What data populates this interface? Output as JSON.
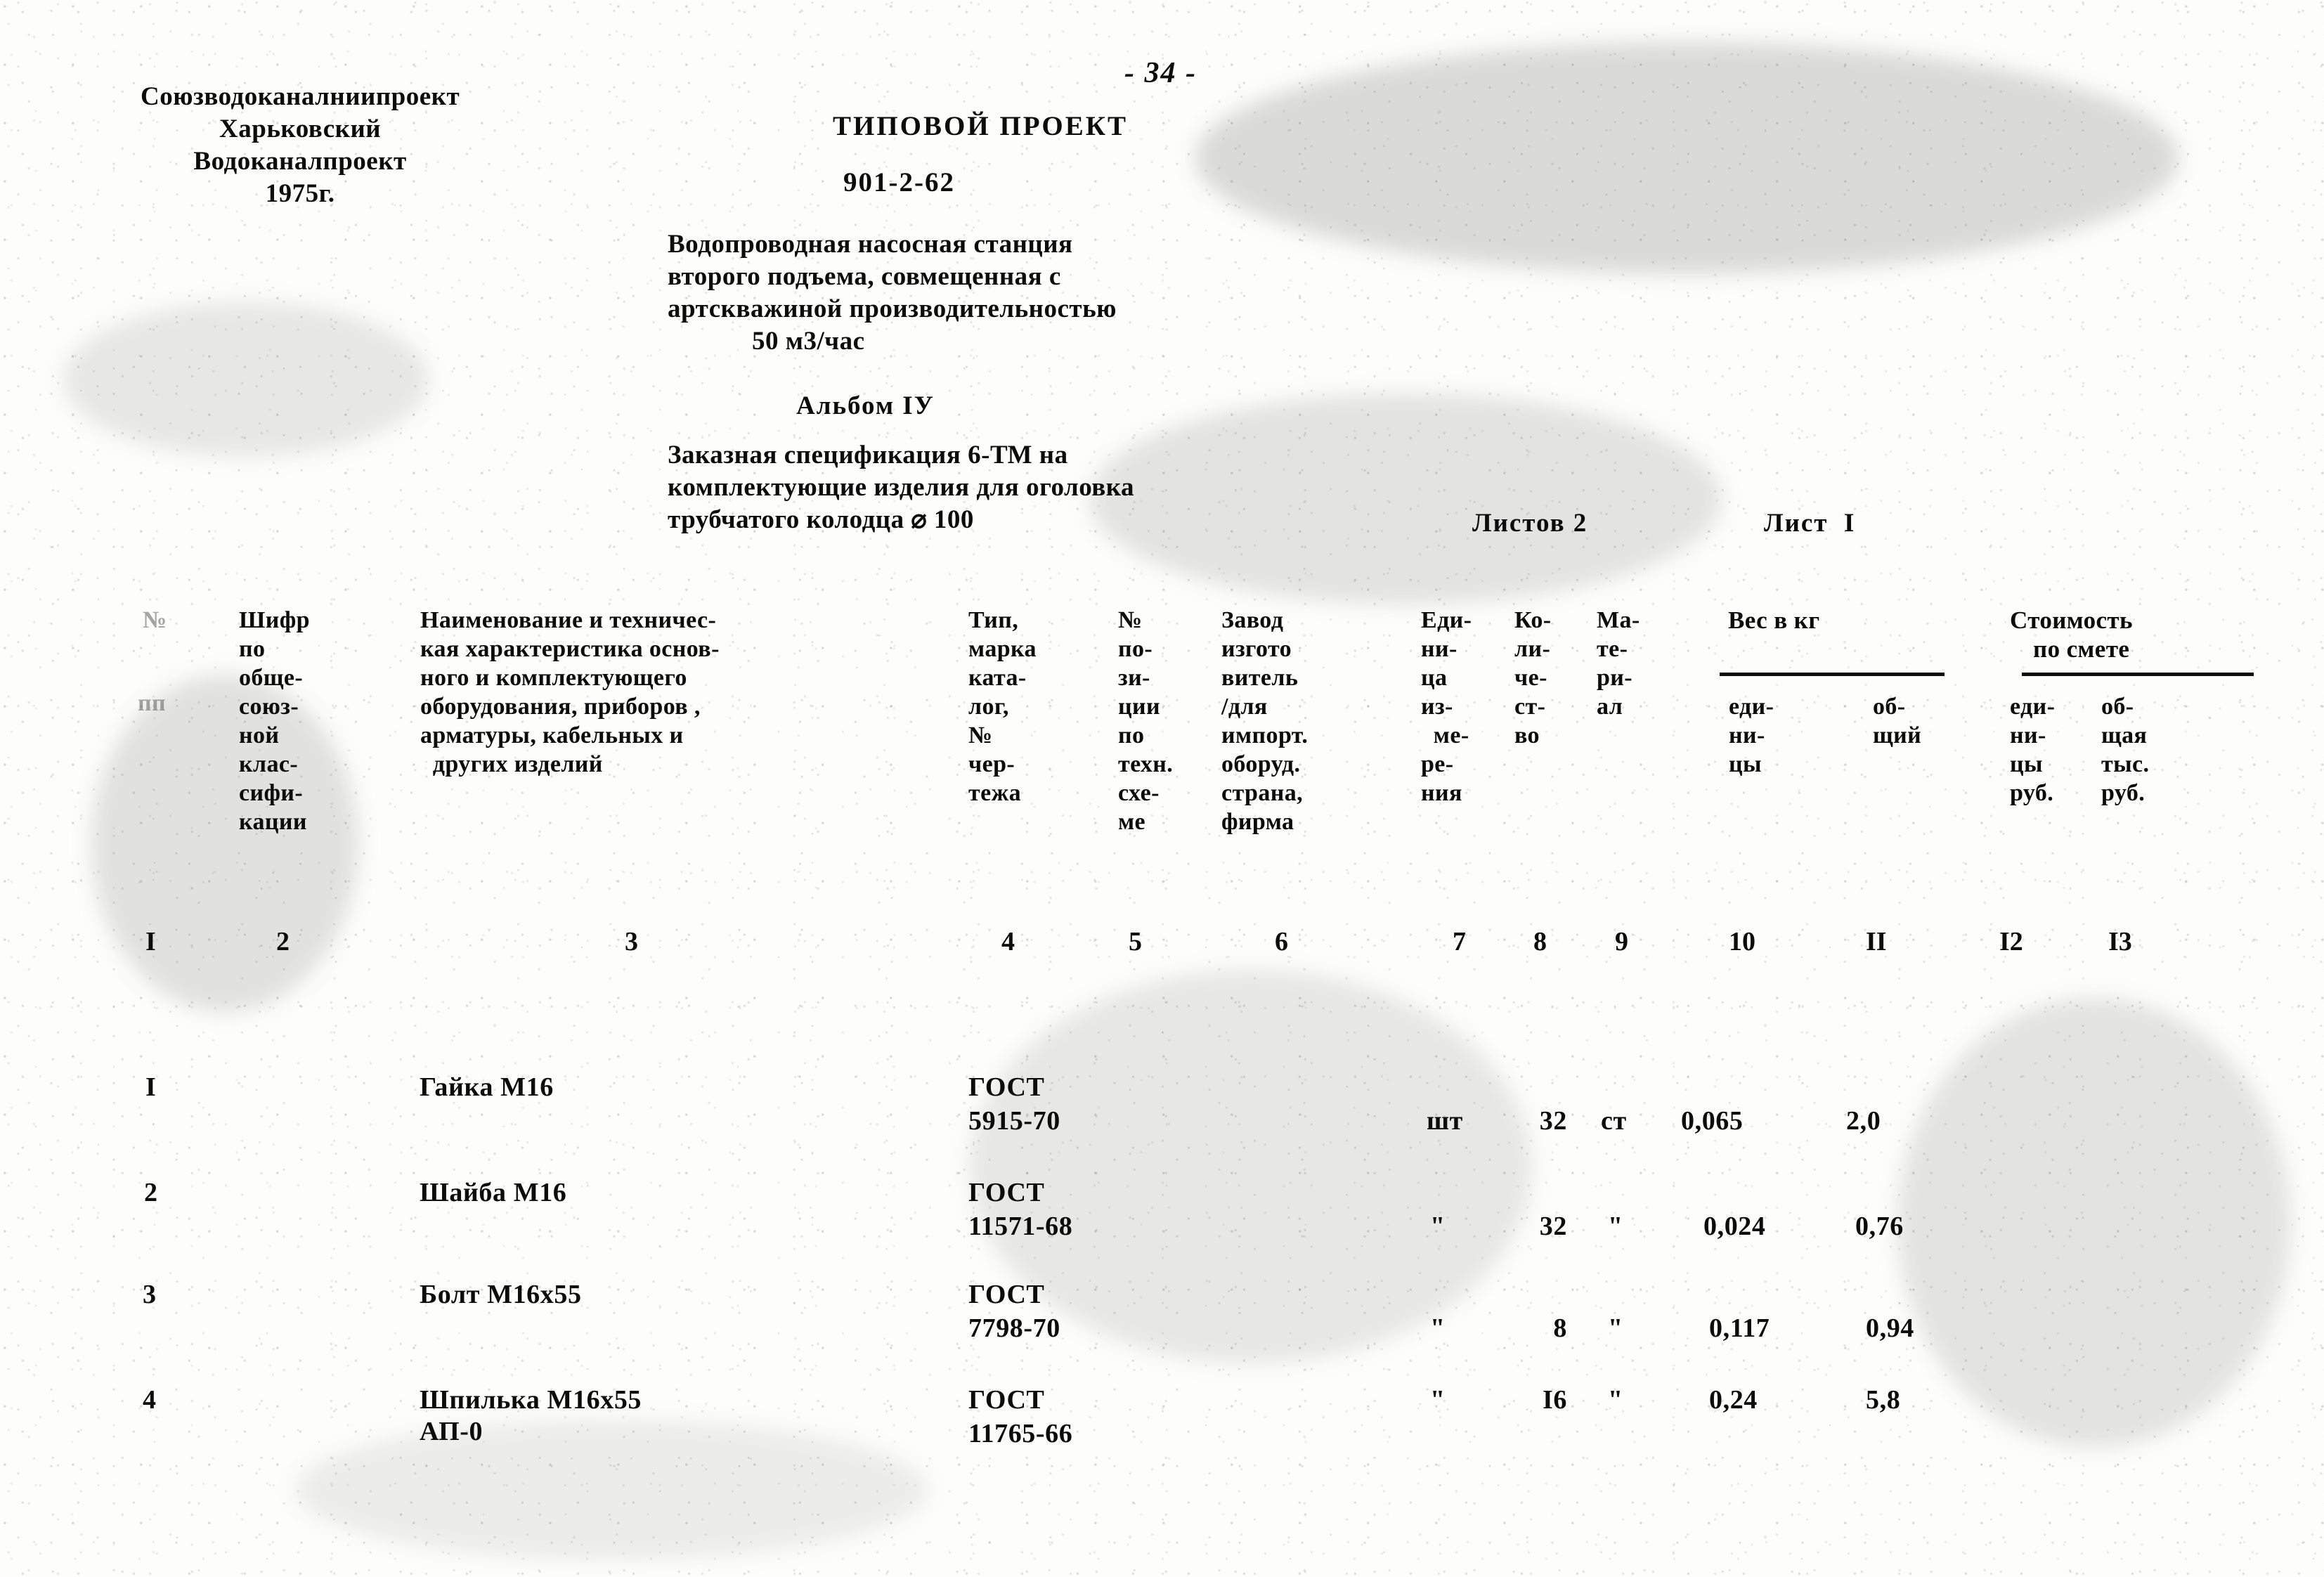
{
  "page": {
    "page_number": "- 34 -",
    "background_color": "#fdfdfb",
    "ink_color": "#0c0c0c"
  },
  "header": {
    "organization": [
      "Союзводоканалниипроект",
      "Харьковский",
      "Водоканалпроект",
      "1975г."
    ],
    "project_label": "ТИПОВОЙ ПРОЕКТ",
    "project_code": "901-2-62",
    "description": [
      "Водопроводная насосная станция",
      "второго подъема, совмещенная с",
      "артскважиной производительностью",
      "50 м3/час"
    ],
    "album": "Альбом IУ",
    "specification": [
      "Заказная спецификация 6-ТМ на",
      "комплектующие изделия для оголовка",
      "трубчатого колодца ⌀ 100"
    ],
    "sheets_total": "Листов 2",
    "sheet_current": "Лист  I"
  },
  "table": {
    "headers": {
      "col1": [
        "№",
        "пп"
      ],
      "col2": [
        "Шифр",
        "по",
        "обще-",
        "союз-",
        "ной",
        "клас-",
        "сифи-",
        "кации"
      ],
      "col3": [
        "Наименование и техничес-",
        "кая характеристика основ-",
        "ного и комплектующего",
        "оборудования, приборов ,",
        "арматуры, кабельных и",
        "  других изделий"
      ],
      "col4": [
        "Тип,",
        "марка",
        "ката-",
        "лог,",
        "№",
        "чер-",
        "тежа"
      ],
      "col5": [
        "№",
        "по-",
        "зи-",
        "ции",
        "по",
        "техн.",
        "схе-",
        "ме"
      ],
      "col6": [
        "Завод",
        "изгото",
        "витель",
        "/для",
        "импорт.",
        "оборуд.",
        "страна,",
        "фирма"
      ],
      "col7": [
        "Еди-",
        "ни-",
        "ца",
        "из-",
        "  ме-",
        "ре-",
        "ния"
      ],
      "col8": [
        "Ко-",
        "ли-",
        "че-",
        "ст-",
        "во"
      ],
      "col9": [
        "Ма-",
        "те-",
        "ри-",
        "ал"
      ],
      "group_weight": "Вес в кг",
      "group_cost": [
        "Стоимость",
        "по смете"
      ],
      "col10": [
        "еди-",
        "ни-",
        "цы"
      ],
      "col11": [
        "об-",
        "щий"
      ],
      "col12": [
        "еди-",
        "ни-",
        "цы",
        "руб."
      ],
      "col13": [
        "об-",
        "щая",
        "тыс.",
        "руб."
      ]
    },
    "column_numbers": [
      "I",
      "2",
      "3",
      "4",
      "5",
      "6",
      "7",
      "8",
      "9",
      "10",
      "II",
      "I2",
      "I3"
    ],
    "rows": [
      {
        "num": "I",
        "code": "",
        "name": [
          "Гайка М16"
        ],
        "type": [
          "ГОСТ",
          "5915-70"
        ],
        "position": "",
        "manufacturer": "",
        "unit": "шт",
        "quantity": "32",
        "material": "ст",
        "weight_unit": "0,065",
        "weight_total": "2,0",
        "cost_unit": "",
        "cost_total": ""
      },
      {
        "num": "2",
        "code": "",
        "name": [
          "Шайба М16"
        ],
        "type": [
          "ГОСТ",
          "11571-68"
        ],
        "position": "",
        "manufacturer": "",
        "unit": "\"",
        "quantity": "32",
        "material": "\"",
        "weight_unit": "0,024",
        "weight_total": "0,76",
        "cost_unit": "",
        "cost_total": ""
      },
      {
        "num": "3",
        "code": "",
        "name": [
          "Болт М16х55"
        ],
        "type": [
          "ГОСТ",
          "7798-70"
        ],
        "position": "",
        "manufacturer": "",
        "unit": "\"",
        "quantity": "8",
        "material": "\"",
        "weight_unit": "0,117",
        "weight_total": "0,94",
        "cost_unit": "",
        "cost_total": ""
      },
      {
        "num": "4",
        "code": "",
        "name": [
          "Шпилька М16х55",
          "АП-0"
        ],
        "type": [
          "ГОСТ",
          "11765-66"
        ],
        "position": "",
        "manufacturer": "",
        "unit": "\"",
        "quantity": "I6",
        "material": "\"",
        "weight_unit": "0,24",
        "weight_total": "5,8",
        "cost_unit": "",
        "cost_total": ""
      }
    ]
  }
}
